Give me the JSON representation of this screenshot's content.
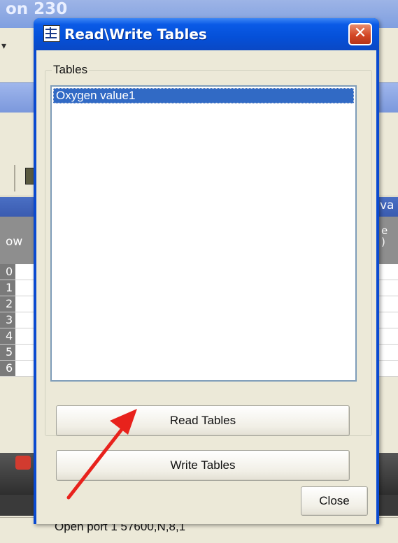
{
  "background_app": {
    "title_fragment": "on 230",
    "header_fragment": "va",
    "column_header_left": "ow",
    "column_header_right": "e\n)",
    "row_numbers": [
      "0",
      "1",
      "2",
      "3",
      "4",
      "5",
      "6"
    ],
    "status_text": "Open port 1 57600,N,8,1"
  },
  "dialog": {
    "title": "Read\\Write Tables",
    "close_glyph": "✕",
    "group_label": "Tables",
    "list_items": [
      "Oxygen value1"
    ],
    "selected_index": 0,
    "read_button": "Read Tables",
    "write_button": "Write Tables",
    "close_button": "Close"
  },
  "annotation": {
    "arrow_color": "#e8221c",
    "target": "read-tables-button"
  },
  "colors": {
    "titlebar_blue": "#0a5ae6",
    "selection_blue": "#316ac5",
    "dialog_face": "#ece9d8",
    "close_red": "#d44726"
  }
}
